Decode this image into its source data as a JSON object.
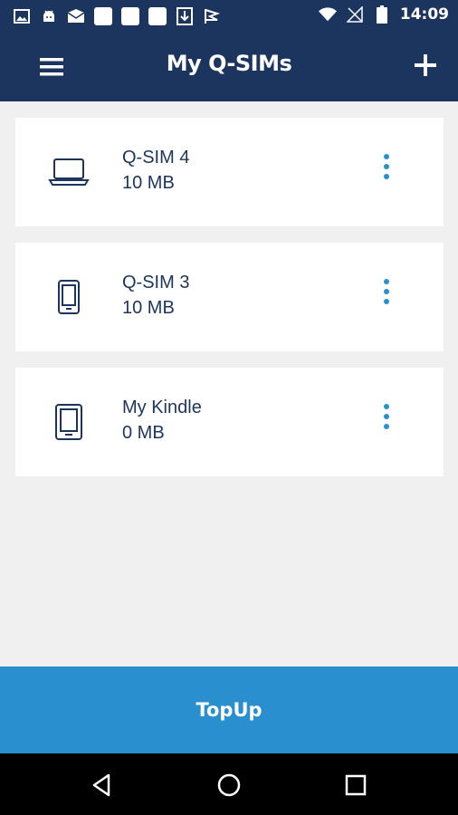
{
  "status_bar": {
    "time": "14:09",
    "left_icons": [
      "image-icon",
      "android-icon",
      "mail-icon",
      "app-icon",
      "app-icon",
      "app-icon",
      "download-icon",
      "check-flag-icon"
    ],
    "right_icons": [
      "wifi-icon",
      "no-signal-icon",
      "battery-icon"
    ]
  },
  "app_bar": {
    "title": "My Q-SIMs",
    "menu_icon": "hamburger-menu-icon",
    "add_icon": "plus-icon"
  },
  "sims": [
    {
      "name": "Q-SIM 4",
      "data": "10 MB",
      "device_icon": "laptop-icon"
    },
    {
      "name": "Q-SIM 3",
      "data": "10 MB",
      "device_icon": "phone-icon"
    },
    {
      "name": "My Kindle",
      "data": "0 MB",
      "device_icon": "tablet-icon"
    }
  ],
  "topup": {
    "label": "TopUp"
  },
  "nav_bar": {
    "buttons": [
      "back-icon",
      "home-icon",
      "recents-icon"
    ]
  },
  "colors": {
    "header": "#1c355e",
    "accent": "#2a8fcf",
    "background": "#f0f0f0",
    "card": "#ffffff",
    "text": "#1c355e"
  }
}
